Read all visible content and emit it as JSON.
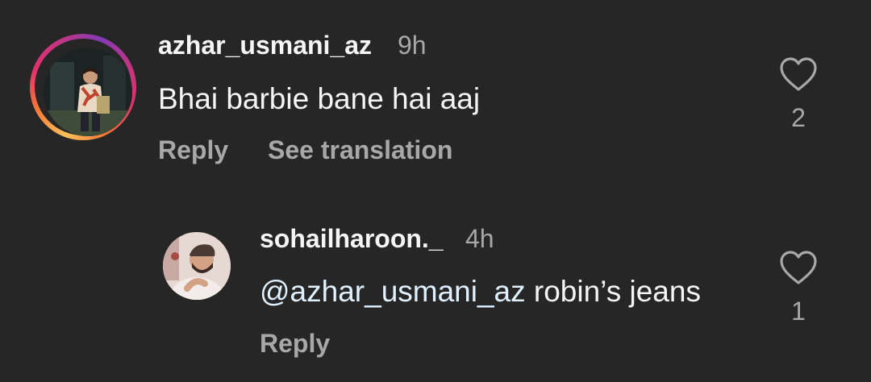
{
  "comments": [
    {
      "username": "azhar_usmani_az",
      "time": "9h",
      "text": "Bhai barbie bane hai aaj",
      "actions": {
        "reply": "Reply",
        "translate": "See translation"
      },
      "likes": "2",
      "icons": {
        "avatar": "avatar-with-story-ring",
        "like": "heart-outline-icon"
      }
    }
  ],
  "replies": [
    {
      "username": "sohailharoon._",
      "time": "4h",
      "mention": "@azhar_usmani_az",
      "text": " robin’s jeans",
      "actions": {
        "reply": "Reply"
      },
      "likes": "1",
      "icons": {
        "avatar": "avatar",
        "like": "heart-outline-icon"
      }
    }
  ],
  "colors": {
    "background": "#262626",
    "primary_text": "#f5f5f5",
    "secondary_text": "#a8a8a8",
    "mention": "#e0f1ff"
  }
}
